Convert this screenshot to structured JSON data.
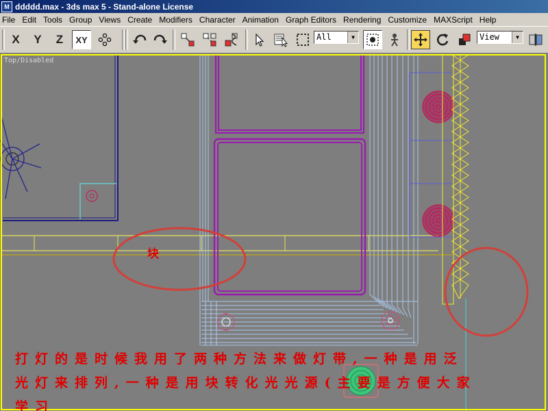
{
  "window": {
    "title": "ddddd.max - 3ds max 5 - Stand-alone License",
    "icon_letter": "M"
  },
  "menu": {
    "items": [
      "File",
      "Edit",
      "Tools",
      "Group",
      "Views",
      "Create",
      "Modifiers",
      "Character",
      "Animation",
      "Graph Editors",
      "Rendering",
      "Customize",
      "MAXScript",
      "Help"
    ]
  },
  "toolbar": {
    "axis_x": "X",
    "axis_y": "Y",
    "axis_z": "Z",
    "axis_xy": "XY",
    "selection_filter": "All",
    "reference_coordinate": "View",
    "icons": [
      "undo-icon",
      "redo-icon",
      "select-link-icon",
      "unlink-icon",
      "bind-spacewarp-icon",
      "select-object-icon",
      "select-by-name-icon",
      "rectangular-selection-icon",
      "window-crossing-icon",
      "select-move-icon",
      "select-rotate-icon",
      "select-scale-icon",
      "mirror-icon",
      "align-icon"
    ]
  },
  "viewport": {
    "label": "Top/Disabled",
    "border_color": "#ffff00",
    "background": "#7e7e7e"
  },
  "annotations": {
    "label": "块",
    "line1": "打灯的是时候我用了两种方法来做灯带,一种是用泛",
    "line2": "光灯来排列,一种是用块转化光光源(主要是方便大家",
    "line3": "学习",
    "color": "#e00000"
  },
  "colors": {
    "purple_frame": "#9a1bb0",
    "light_blue_lines": "#a9c8ec",
    "yellow_lights": "#f2e82a",
    "pink_lights": "#c8144e",
    "navy_lines": "#1c1c80",
    "green_light": "#33d17a"
  }
}
